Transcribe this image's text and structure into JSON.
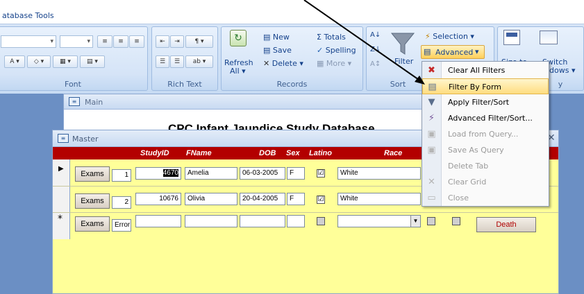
{
  "ribbon": {
    "tab_label": "atabase Tools",
    "groups": {
      "font": "Font",
      "rich_text": "Rich Text",
      "records": "Records",
      "sort_filter": "Sort",
      "window": "y"
    },
    "records": {
      "refresh": "Refresh",
      "refresh_sub": "All",
      "new": "New",
      "save": "Save",
      "delete": "Delete",
      "totals": "Totals",
      "spelling": "Spelling",
      "more": "More"
    },
    "sort_filter": {
      "filter": "Filter",
      "selection": "Selection",
      "advanced": "Advanced"
    },
    "window": {
      "size": "Size to",
      "switch": "Switch",
      "windows": "dows"
    }
  },
  "main_window": {
    "title": "Main",
    "heading": "CPC Infant Jaundice Study Database"
  },
  "master_form": {
    "title": "Master",
    "columns": [
      "StudyID",
      "FName",
      "DOB",
      "Sex",
      "Latino",
      "Race"
    ],
    "exams_label": "Exams",
    "death_label": "Death",
    "rows": [
      {
        "marker": "▶",
        "num": "1",
        "study_id": "4670",
        "fname": "Amelia",
        "dob": "06-03-2005",
        "sex": "F",
        "latino": "☑",
        "race": "White"
      },
      {
        "marker": "",
        "num": "2",
        "study_id": "10676",
        "fname": "Olivia",
        "dob": "20-04-2005",
        "sex": "F",
        "latino": "☑",
        "race": "White"
      },
      {
        "marker": "*",
        "num": "Error",
        "study_id": "",
        "fname": "",
        "dob": "",
        "sex": "",
        "latino": "",
        "race": ""
      }
    ]
  },
  "advanced_menu": {
    "items": [
      {
        "label": "Clear All Filters",
        "enabled": true
      },
      {
        "label": "Filter By Form",
        "enabled": true,
        "highlighted": true
      },
      {
        "label": "Apply Filter/Sort",
        "enabled": true
      },
      {
        "label": "Advanced Filter/Sort...",
        "enabled": true
      },
      {
        "label": "Load from Query...",
        "enabled": false
      },
      {
        "label": "Save As Query",
        "enabled": false
      },
      {
        "label": "Delete Tab",
        "enabled": false
      },
      {
        "label": "Clear Grid",
        "enabled": false
      },
      {
        "label": "Close",
        "enabled": false
      }
    ]
  },
  "colors": {
    "header_red": "#b30000",
    "form_yellow": "#ffff99",
    "highlight": "#ffdd80"
  }
}
